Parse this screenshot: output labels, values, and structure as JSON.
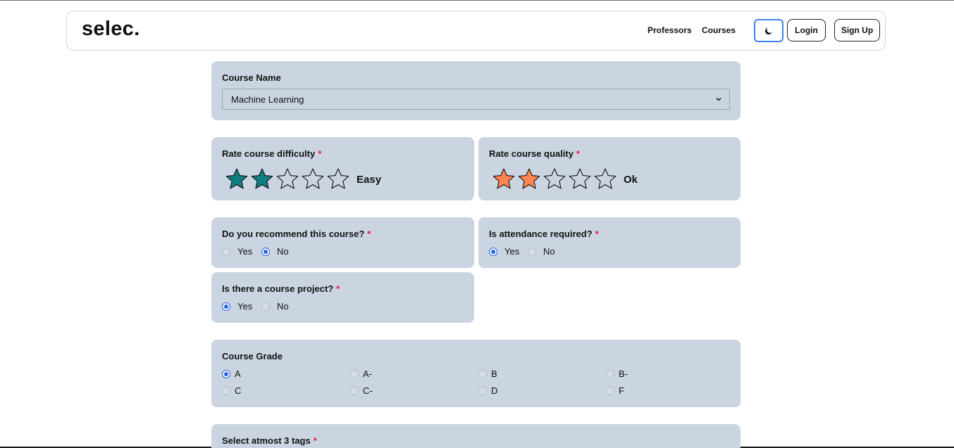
{
  "nav": {
    "logo": "selec.",
    "links": [
      "Professors",
      "Courses"
    ],
    "login": "Login",
    "signup": "Sign Up",
    "theme_icon": "moon-icon"
  },
  "course": {
    "label": "Course Name",
    "value": "Machine Learning"
  },
  "difficulty": {
    "label": "Rate course difficulty",
    "required": "*",
    "rating": 2,
    "max": 5,
    "rating_text": "Easy",
    "color": "#0f7f7f"
  },
  "quality": {
    "label": "Rate course quality",
    "required": "*",
    "rating": 2,
    "max": 5,
    "rating_text": "Ok",
    "color": "#ff8552"
  },
  "recommend": {
    "label": "Do you recommend this course?",
    "required": "*",
    "options": [
      "Yes",
      "No"
    ],
    "selected": "No"
  },
  "attendance": {
    "label": "Is attendance required?",
    "required": "*",
    "options": [
      "Yes",
      "No"
    ],
    "selected": "Yes"
  },
  "project": {
    "label": "Is there a course project?",
    "required": "*",
    "options": [
      "Yes",
      "No"
    ],
    "selected": "Yes"
  },
  "grade": {
    "label": "Course Grade",
    "options": [
      "A",
      "A-",
      "B",
      "B-",
      "C",
      "C-",
      "D",
      "F"
    ],
    "selected": "A"
  },
  "tags": {
    "label": "Select atmost 3 tags",
    "required": "*"
  },
  "colors": {
    "card_bg": "#cbd5e1",
    "accent": "#2563eb",
    "required": "#e11d48"
  }
}
